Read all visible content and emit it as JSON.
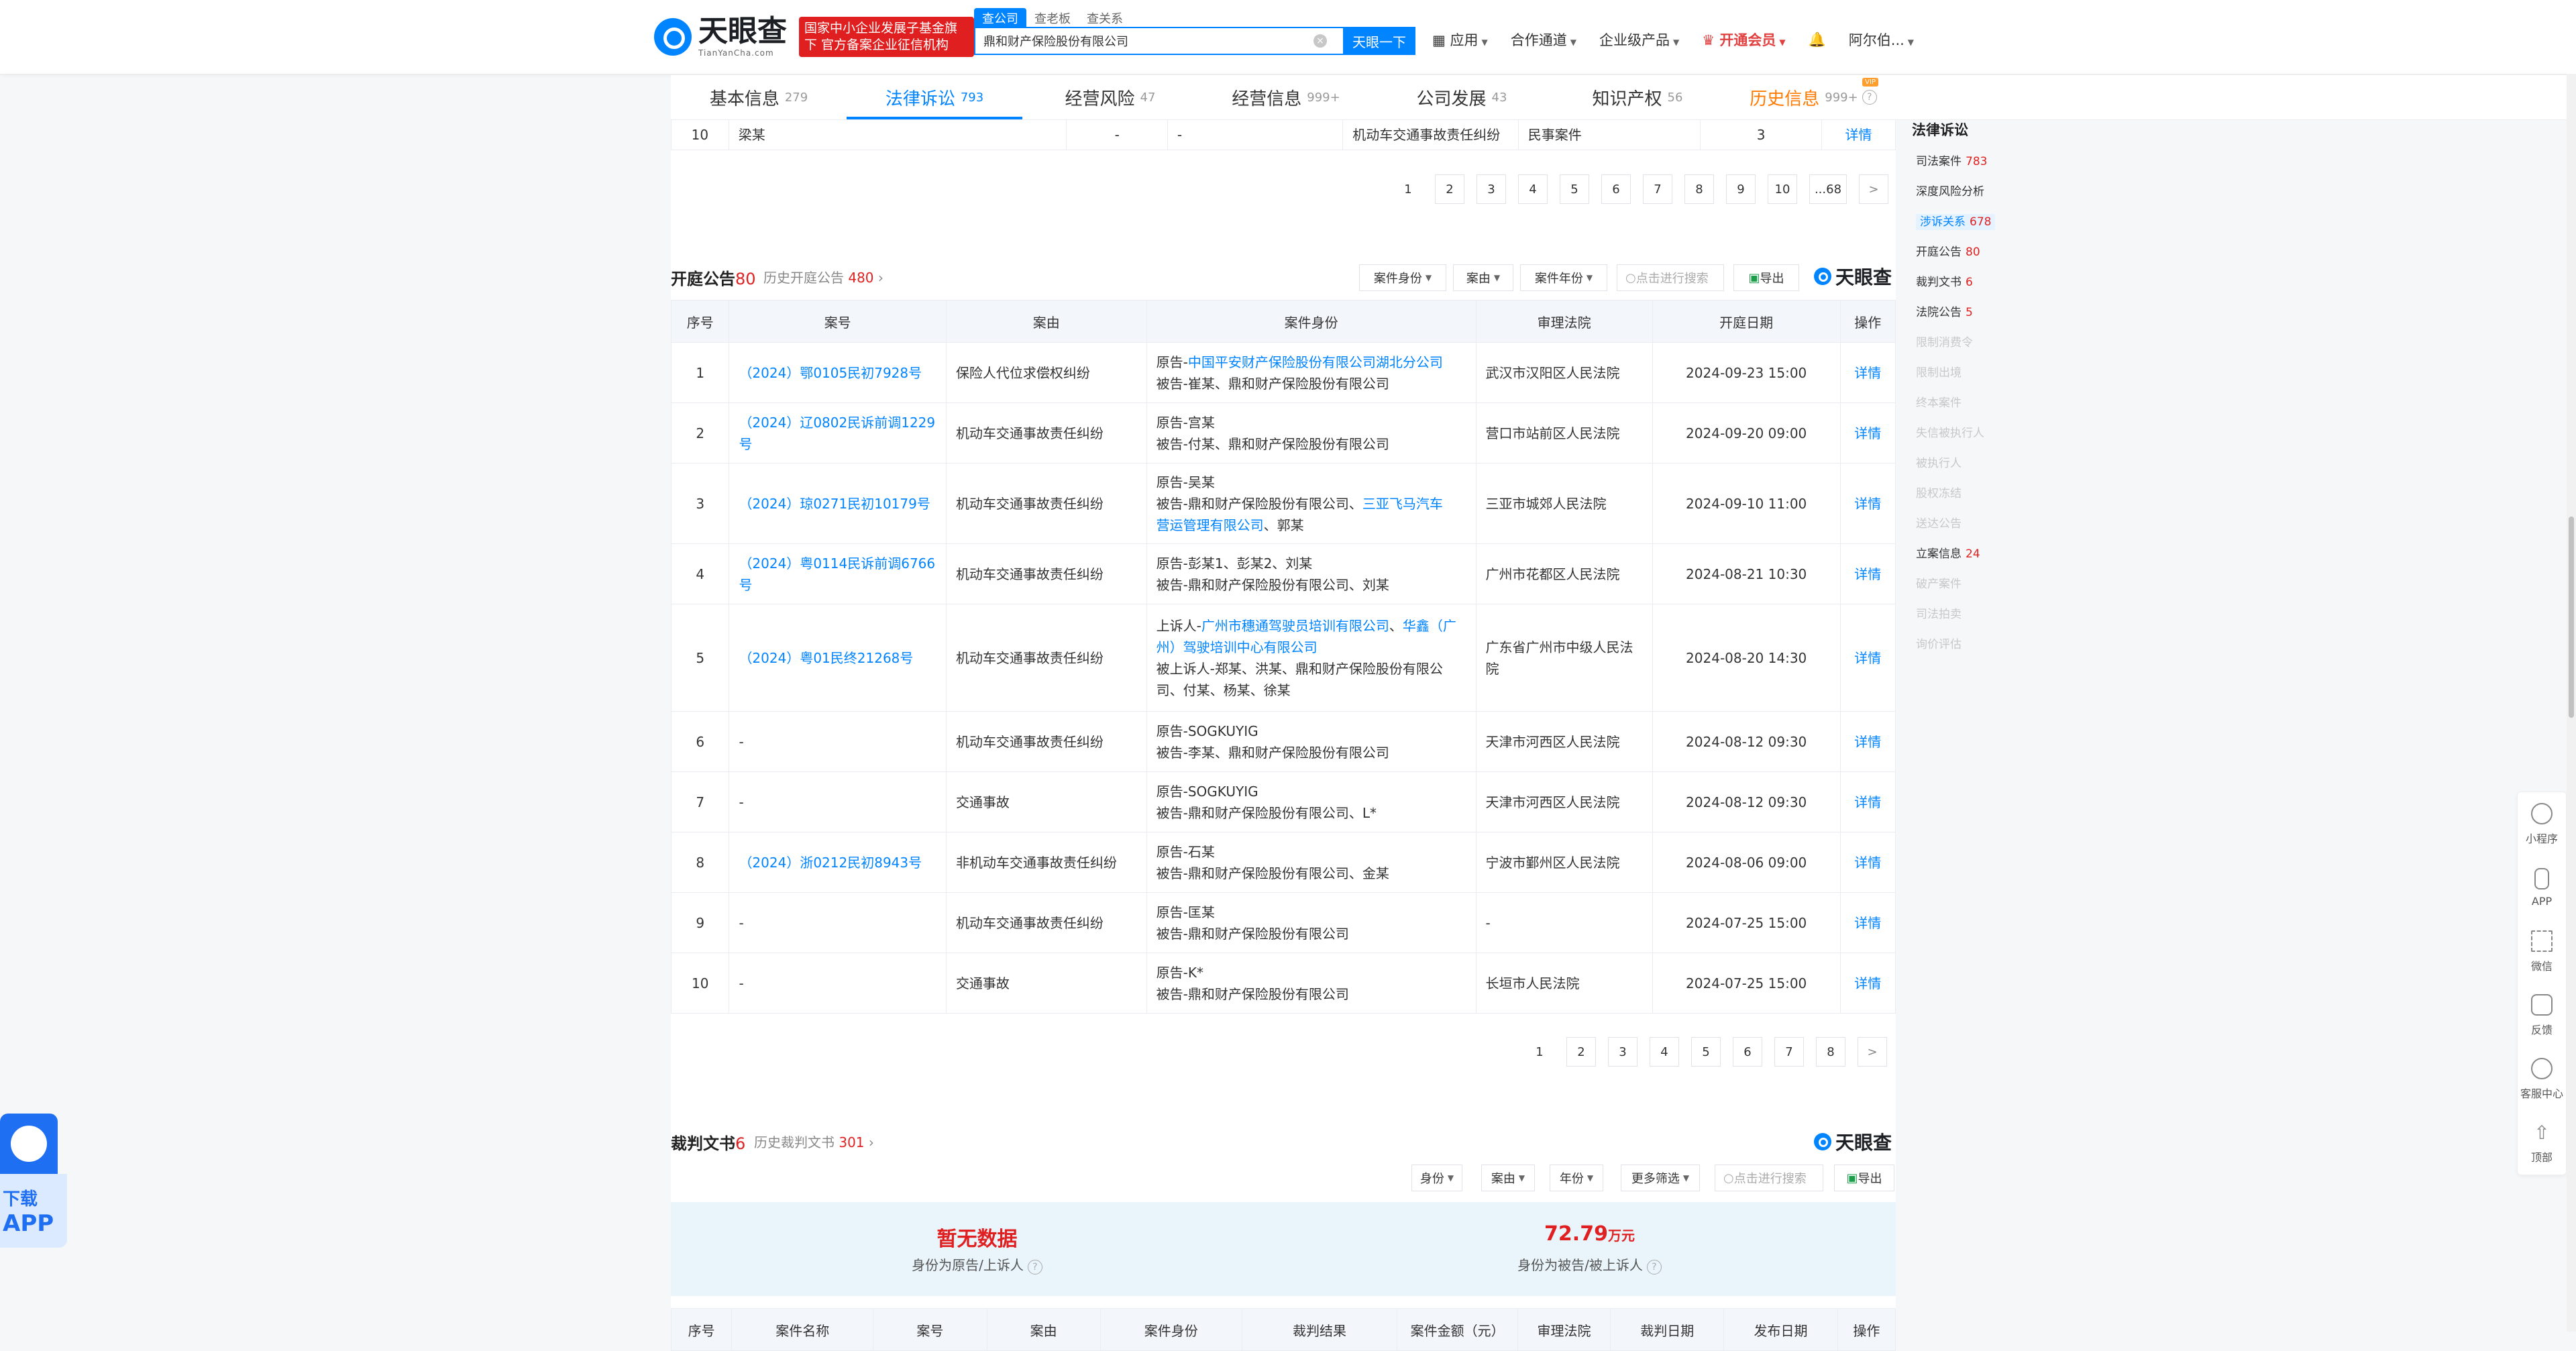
{
  "header": {
    "logo_cn": "天眼查",
    "logo_en": "TianYanCha.com",
    "badge": "国家中小企业发展子基金旗下 官方备案企业征信机构",
    "search_tabs": [
      "查公司",
      "查老板",
      "查关系"
    ],
    "search_value": "鼎和财产保险股份有限公司",
    "search_button": "天眼一下",
    "nav": [
      "应用",
      "合作通道",
      "企业级产品",
      "开通会员",
      "阿尔伯..."
    ]
  },
  "tabs": [
    {
      "label": "基本信息",
      "count": "279"
    },
    {
      "label": "法律诉讼",
      "count": "793"
    },
    {
      "label": "经营风险",
      "count": "47"
    },
    {
      "label": "经营信息",
      "count": "999+"
    },
    {
      "label": "公司发展",
      "count": "43"
    },
    {
      "label": "知识产权",
      "count": "56"
    },
    {
      "label": "历史信息",
      "count": "999+",
      "tag": "VIP"
    }
  ],
  "prev_row": {
    "no": "10",
    "party": "梁某",
    "c3": "-",
    "c4": "-",
    "cause": "机动车交通事故责任纠纷",
    "type": "民事案件",
    "count": "3",
    "action": "详情"
  },
  "pager1": [
    "1",
    "2",
    "3",
    "4",
    "5",
    "6",
    "7",
    "8",
    "9",
    "10",
    "...68",
    ">"
  ],
  "hearing": {
    "title": "开庭公告",
    "count": "80",
    "history_label": "历史开庭公告",
    "history_count": "480",
    "filters": [
      "案件身份",
      "案由",
      "案件年份"
    ],
    "search_placeholder": "点击进行搜索",
    "export": "导出",
    "brand": "天眼查",
    "columns": [
      "序号",
      "案号",
      "案由",
      "案件身份",
      "审理法院",
      "开庭日期",
      "操作"
    ],
    "rows": [
      {
        "no": "1",
        "case": "（2024）鄂0105民初7928号",
        "cause": "保险人代位求偿权纠纷",
        "p1": "原告-中国平安财产保险股份有限公司湖北分公司",
        "p2": "被告-崔某、鼎和财产保险股份有限公司",
        "p3": "",
        "court": "武汉市汉阳区人民法院",
        "date": "2024-09-23 15:00",
        "action": "详情"
      },
      {
        "no": "2",
        "case": "（2024）辽0802民诉前调1229号",
        "cause": "机动车交通事故责任纠纷",
        "p1": "原告-宫某",
        "p2": "被告-付某、鼎和财产保险股份有限公司",
        "p3": "",
        "court": "营口市站前区人民法院",
        "date": "2024-09-20 09:00",
        "action": "详情"
      },
      {
        "no": "3",
        "case": "（2024）琼0271民初10179号",
        "cause": "机动车交通事故责任纠纷",
        "p1": "原告-吴某",
        "p2": "被告-鼎和财产保险股份有限公司、三亚飞马汽车",
        "p3": "营运管理有限公司、郭某",
        "court": "三亚市城郊人民法院",
        "date": "2024-09-10 11:00",
        "action": "详情"
      },
      {
        "no": "4",
        "case": "（2024）粤0114民诉前调6766号",
        "cause": "机动车交通事故责任纠纷",
        "p1": "原告-彭某1、彭某2、刘某",
        "p2": "被告-鼎和财产保险股份有限公司、刘某",
        "p3": "",
        "court": "广州市花都区人民法院",
        "date": "2024-08-21 10:30",
        "action": "详情"
      },
      {
        "no": "5",
        "case": "（2024）粤01民终21268号",
        "cause": "机动车交通事故责任纠纷",
        "p1": "上诉人-广州市穗通驾驶员培训有限公司、华鑫（广州）驾驶培训中心有限公司",
        "p2": "被上诉人-郑某、洪某、鼎和财产保险股份有限公",
        "p3": "司、付某、杨某、徐某",
        "court": "广东省广州市中级人民法院",
        "date": "2024-08-20 14:30",
        "action": "详情"
      },
      {
        "no": "6",
        "case": "-",
        "cause": "机动车交通事故责任纠纷",
        "p1": "原告-SOGKUYIG",
        "p2": "被告-李某、鼎和财产保险股份有限公司",
        "p3": "",
        "court": "天津市河西区人民法院",
        "date": "2024-08-12 09:30",
        "action": "详情"
      },
      {
        "no": "7",
        "case": "-",
        "cause": "交通事故",
        "p1": "原告-SOGKUYIG",
        "p2": "被告-鼎和财产保险股份有限公司、L*",
        "p3": "",
        "court": "天津市河西区人民法院",
        "date": "2024-08-12 09:30",
        "action": "详情"
      },
      {
        "no": "8",
        "case": "（2024）浙0212民初8943号",
        "cause": "非机动车交通事故责任纠纷",
        "p1": "原告-石某",
        "p2": "被告-鼎和财产保险股份有限公司、金某",
        "p3": "",
        "court": "宁波市鄞州区人民法院",
        "date": "2024-08-06 09:00",
        "action": "详情"
      },
      {
        "no": "9",
        "case": "-",
        "cause": "机动车交通事故责任纠纷",
        "p1": "原告-匡某",
        "p2": "被告-鼎和财产保险股份有限公司",
        "p3": "",
        "court": "-",
        "date": "2024-07-25 15:00",
        "action": "详情"
      },
      {
        "no": "10",
        "case": "-",
        "cause": "交通事故",
        "p1": "原告-K*",
        "p2": "被告-鼎和财产保险股份有限公司",
        "p3": "",
        "court": "长垣市人民法院",
        "date": "2024-07-25 15:00",
        "action": "详情"
      }
    ]
  },
  "pager2": [
    "1",
    "2",
    "3",
    "4",
    "5",
    "6",
    "7",
    "8",
    ">"
  ],
  "judgment": {
    "title": "裁判文书",
    "count": "6",
    "history_label": "历史裁判文书",
    "history_count": "301",
    "brand": "天眼查",
    "filters": [
      "身份",
      "案由",
      "年份",
      "更多筛选"
    ],
    "search_placeholder": "点击进行搜索",
    "export": "导出",
    "stat1_value": "暂无数据",
    "stat1_label": "身份为原告/上诉人",
    "stat2_value": "72.79",
    "stat2_unit": "万元",
    "stat2_label": "身份为被告/被上诉人",
    "columns": [
      "序号",
      "案件名称",
      "案号",
      "案由",
      "案件身份",
      "裁判结果",
      "案件金额（元）",
      "审理法院",
      "裁判日期",
      "发布日期",
      "操作"
    ]
  },
  "sidebar": {
    "title": "法律诉讼",
    "items": [
      {
        "label": "司法案件",
        "n": "783"
      },
      {
        "label": "深度风险分析",
        "n": ""
      },
      {
        "label": "涉诉关系",
        "n": "678"
      },
      {
        "label": "开庭公告",
        "n": "80"
      },
      {
        "label": "裁判文书",
        "n": "6"
      },
      {
        "label": "法院公告",
        "n": "5"
      },
      {
        "label": "限制消费令",
        "n": ""
      },
      {
        "label": "限制出境",
        "n": ""
      },
      {
        "label": "终本案件",
        "n": ""
      },
      {
        "label": "失信被执行人",
        "n": ""
      },
      {
        "label": "被执行人",
        "n": ""
      },
      {
        "label": "股权冻结",
        "n": ""
      },
      {
        "label": "送达公告",
        "n": ""
      },
      {
        "label": "立案信息",
        "n": "24"
      },
      {
        "label": "破产案件",
        "n": ""
      },
      {
        "label": "司法拍卖",
        "n": ""
      },
      {
        "label": "询价评估",
        "n": ""
      }
    ]
  },
  "right_rail": [
    "小程序",
    "APP",
    "微信",
    "反馈",
    "客服中心",
    "顶部"
  ],
  "app_float": {
    "l1": "下载",
    "l2": "APP"
  }
}
